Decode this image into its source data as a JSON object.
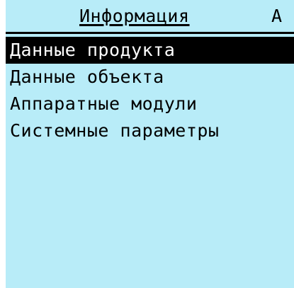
{
  "header": {
    "title": "Информация",
    "indicator": "А"
  },
  "menu": {
    "selected_index": 0,
    "items": [
      {
        "label": "Данные продукта"
      },
      {
        "label": "Данные объекта"
      },
      {
        "label": "Аппаратные модули"
      },
      {
        "label": "Системные параметры"
      }
    ]
  },
  "colors": {
    "screen_background": "#b8ecf8",
    "selection_background": "#000000",
    "selection_text": "#ffffff",
    "text": "#000000"
  }
}
